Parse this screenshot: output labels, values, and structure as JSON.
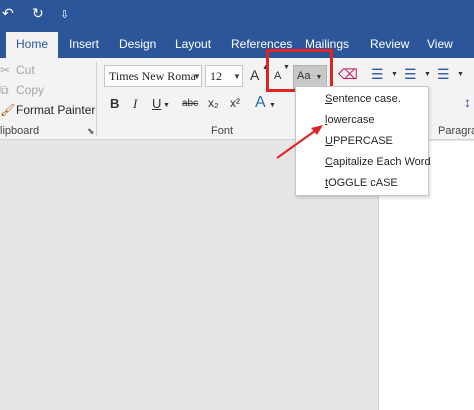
{
  "quick_access": {
    "undo_icon": "↶",
    "redo_icon": "↻",
    "customize_icon": "⇩"
  },
  "tabs": [
    {
      "label": "Home"
    },
    {
      "label": "Insert"
    },
    {
      "label": "Design"
    },
    {
      "label": "Layout"
    },
    {
      "label": "References"
    },
    {
      "label": "Mailings"
    },
    {
      "label": "Review"
    },
    {
      "label": "View"
    }
  ],
  "clipboard": {
    "cut_label": "Cut",
    "copy_label": "Copy",
    "format_painter_label": "Format Painter",
    "group_label": "lipboard"
  },
  "font": {
    "font_name": "Times New Roma",
    "font_size": "12",
    "grow_label": "A",
    "shrink_label": "A",
    "case_label": "Aa",
    "bold": "B",
    "italic": "I",
    "underline": "U",
    "strikethrough": "abc",
    "subscript": "x₂",
    "superscript": "x²",
    "text_effects": "A",
    "group_label": "Font"
  },
  "paragraph": {
    "group_label": "Paragra"
  },
  "change_case_menu": {
    "sentence_case_prefix": "S",
    "sentence_case_rest": "entence case.",
    "lowercase_prefix": "l",
    "lowercase_rest": "owercase",
    "uppercase_prefix": "U",
    "uppercase_rest": "PPERCASE",
    "capitalize_prefix": "C",
    "capitalize_rest": "apitalize Each Word",
    "toggle_prefix": "t",
    "toggle_rest": "OGGLE cASE"
  },
  "colors": {
    "ribbon_blue": "#2b579a",
    "highlight_red": "#e02424"
  }
}
